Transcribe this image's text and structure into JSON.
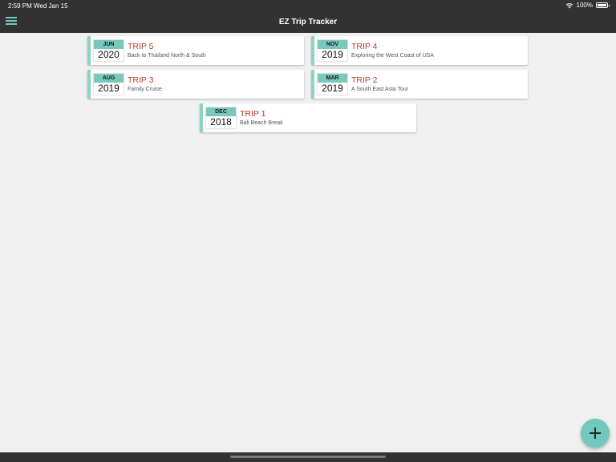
{
  "status_bar": {
    "time": "2:59 PM",
    "date": "Wed Jan 15",
    "battery": "100%"
  },
  "header": {
    "title": "EZ Trip Tracker"
  },
  "trips": [
    {
      "month": "JUN",
      "year": "2020",
      "name": "TRIP 5",
      "description": "Back to Thailand North & South"
    },
    {
      "month": "NOV",
      "year": "2019",
      "name": "TRIP 4",
      "description": "Exploring the West Coast of USA"
    },
    {
      "month": "AUG",
      "year": "2019",
      "name": "TRIP 3",
      "description": "Family Cruise"
    },
    {
      "month": "MAR",
      "year": "2019",
      "name": "TRIP 2",
      "description": "A South East Asia Tour"
    },
    {
      "month": "DEC",
      "year": "2018",
      "name": "TRIP 1",
      "description": "Bali Beach Break"
    }
  ],
  "icons": {
    "menu": "hamburger-icon",
    "add": "plus-icon",
    "wifi": "wifi-icon",
    "battery": "battery-icon"
  },
  "colors": {
    "header_bg": "#323232",
    "accent": "#6fc9bd",
    "trip_name": "#c0392b"
  }
}
